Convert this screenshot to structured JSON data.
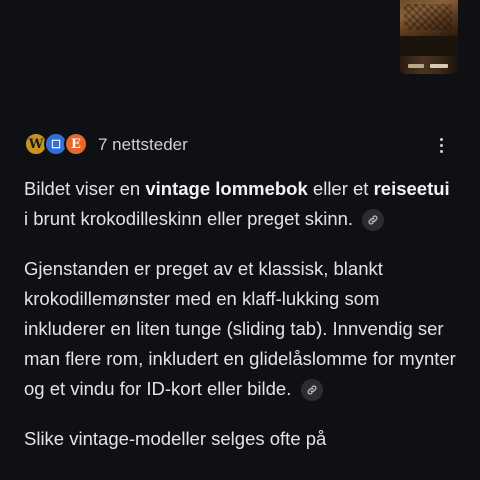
{
  "image_thumbnail": {
    "icon": "wallet-image-thumbnail"
  },
  "sources": {
    "favicons": [
      {
        "letter": "W",
        "color": "#c8941e"
      },
      {
        "letter": "☐",
        "color": "#2f6fd6"
      },
      {
        "letter": "E",
        "color": "#e8672a"
      }
    ],
    "label": "7 nettsteder"
  },
  "answer": {
    "p1": {
      "t1": "Bildet viser en ",
      "b1": "vintage lommebok",
      "t2": " eller et ",
      "b2": "reiseetui",
      "t3": " i brunt krokodilleskinn eller preget skinn."
    },
    "p2": {
      "text": "Gjenstanden er preget av et klassisk, blankt krokodillemønster med en klaff-lukking som inkluderer en liten tunge (sliding tab). Innvendig ser man flere rom, inkludert en glidelåslomme for mynter og et vindu for ID-kort eller bilde."
    },
    "p3": {
      "text": "Slike vintage-modeller selges ofte på"
    }
  }
}
